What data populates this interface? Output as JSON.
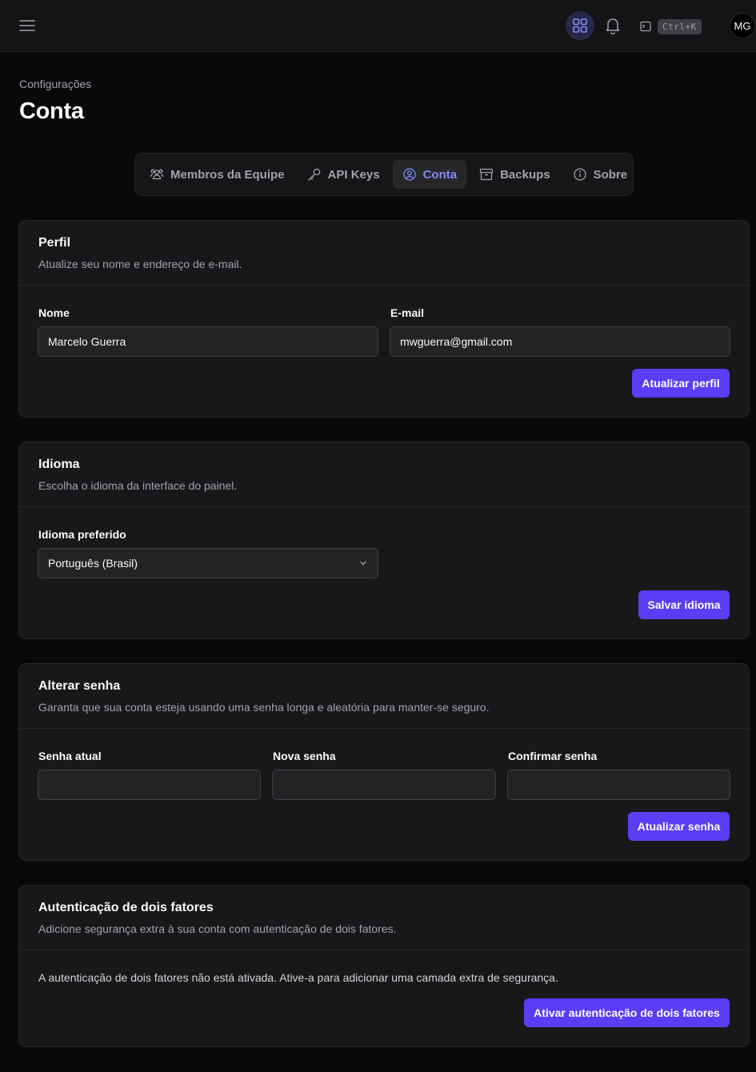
{
  "topbar": {
    "menu_icon": "menu-icon",
    "apps_icon": "apps-grid-icon",
    "bell_icon": "bell-icon",
    "command_icon": "terminal-icon",
    "shortcut": "Ctrl+K",
    "avatar_initials": "MG"
  },
  "header": {
    "breadcrumb": "Configurações",
    "title": "Conta"
  },
  "tabs": [
    {
      "label": "Membros da Equipe",
      "icon": "users-icon"
    },
    {
      "label": "API Keys",
      "icon": "key-icon"
    },
    {
      "label": "Conta",
      "icon": "user-circle-icon",
      "active": true
    },
    {
      "label": "Backups",
      "icon": "archive-icon"
    },
    {
      "label": "Sobre",
      "icon": "info-icon"
    }
  ],
  "profile": {
    "title": "Perfil",
    "description": "Atualize seu nome e endereço de e-mail.",
    "name_label": "Nome",
    "name_value": "Marcelo Guerra",
    "email_label": "E-mail",
    "email_value": "mwguerra@gmail.com",
    "submit": "Atualizar perfil"
  },
  "language": {
    "title": "Idioma",
    "description": "Escolha o idioma da interface do painel.",
    "select_label": "Idioma preferido",
    "selected": "Português (Brasil)",
    "submit": "Salvar idioma"
  },
  "password": {
    "title": "Alterar senha",
    "description": "Garanta que sua conta esteja usando uma senha longa e aleatória para manter-se seguro.",
    "current_label": "Senha atual",
    "new_label": "Nova senha",
    "confirm_label": "Confirmar senha",
    "submit": "Atualizar senha"
  },
  "two_factor": {
    "title": "Autenticação de dois fatores",
    "description": "Adicione segurança extra à sua conta com autenticação de dois fatores.",
    "status": "A autenticação de dois fatores não está ativada. Ative-a para adicionar uma camada extra de segurança.",
    "submit": "Ativar autenticação de dois fatores"
  },
  "colors": {
    "accent": "#5b3df5",
    "active_tab_text": "#818cf8",
    "background": "#09090b",
    "card": "#18181b"
  }
}
